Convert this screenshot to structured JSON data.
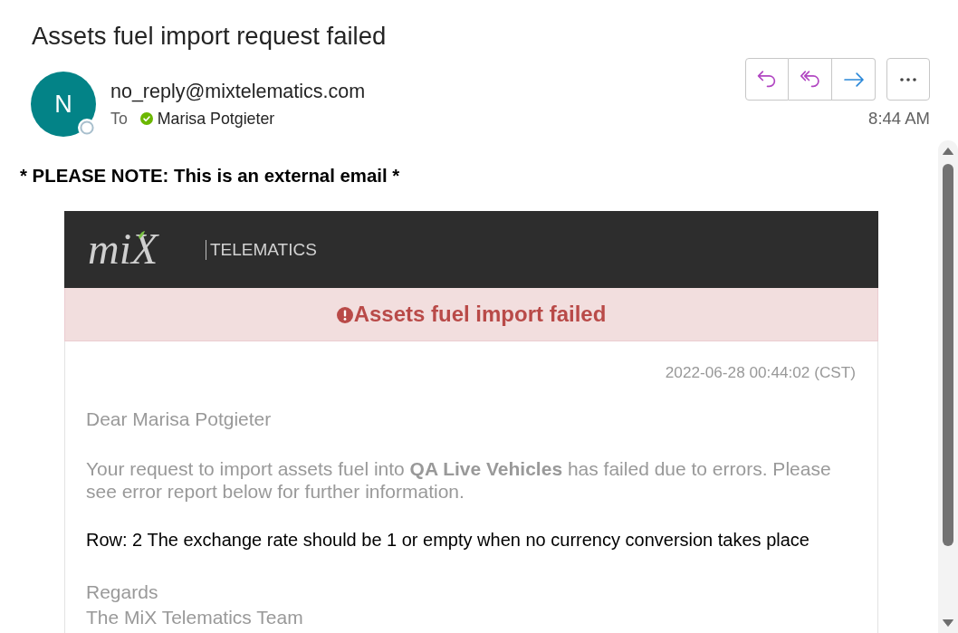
{
  "message": {
    "subject": "Assets fuel import request failed",
    "sender": {
      "initial": "N",
      "address": "no_reply@mixtelematics.com",
      "online": false
    },
    "to_label": "To",
    "recipients": [
      {
        "name": "Marisa Potgieter",
        "online": true
      }
    ],
    "time": "8:44 AM"
  },
  "external_notice": "* PLEASE NOTE: This is an external email *",
  "email": {
    "logo": {
      "wordmark": "miX",
      "tagline": "TELEMATICS"
    },
    "alert": "Assets fuel import failed",
    "timestamp": "2022-06-28 00:44:02 (CST)",
    "greeting": "Dear Marisa Potgieter",
    "paragraphs": [
      "Your request to import assets fuel into **QA Live Vehicles** has failed due to errors. Please see error report below for further information."
    ],
    "errors": [
      "Row: 2 The exchange rate should be 1 or empty when no currency conversion takes place"
    ],
    "closing": "Regards",
    "signature": "The MiX Telematics Team"
  }
}
